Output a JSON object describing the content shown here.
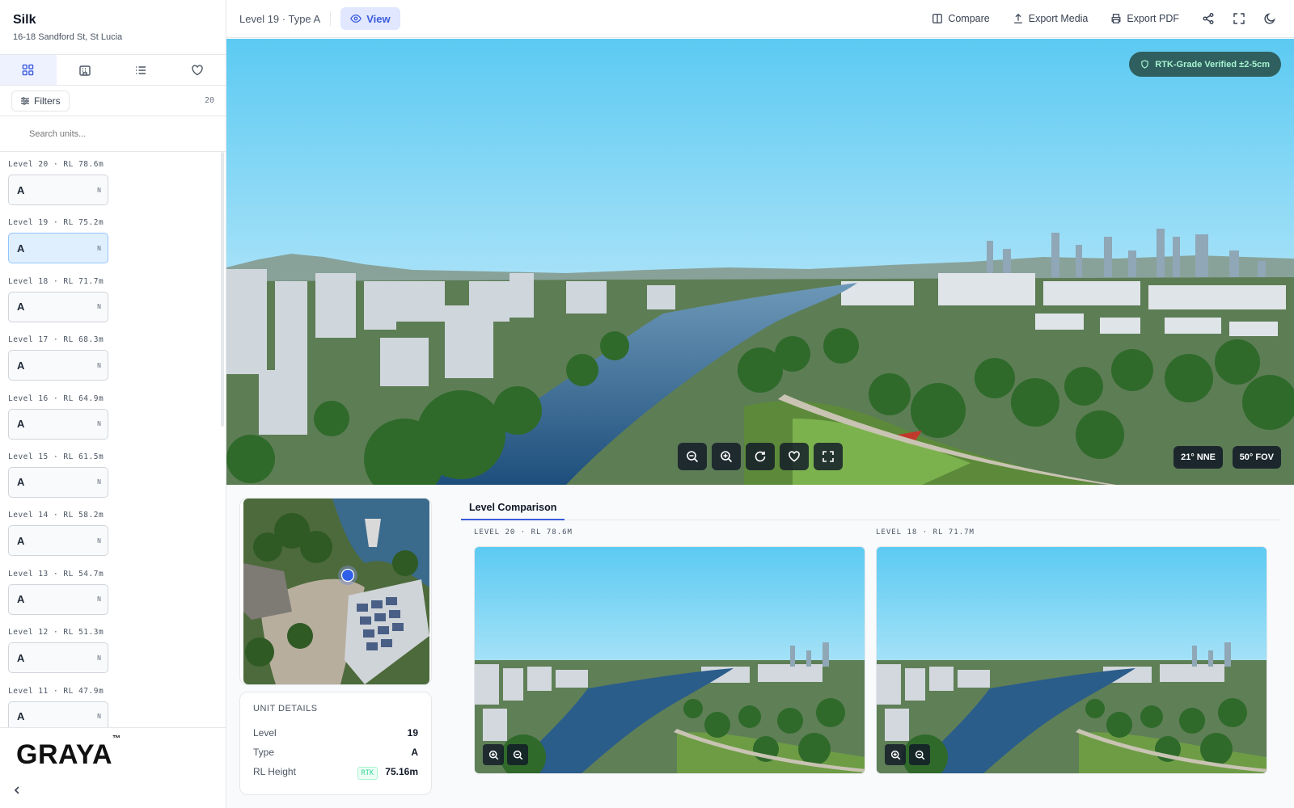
{
  "project": {
    "name": "Silk",
    "address": "16-18 Sandford St, St Lucia"
  },
  "sidebar": {
    "tabs": [
      {
        "icon": "grid-icon"
      },
      {
        "icon": "building-icon"
      },
      {
        "icon": "list-icon"
      },
      {
        "icon": "heart-icon"
      }
    ],
    "filters_label": "Filters",
    "unit_count": "20",
    "search_placeholder": "Search units...",
    "levels": [
      {
        "label": "Level 20 · RL 78.6m",
        "type": "A",
        "orientation": "N",
        "selected": false
      },
      {
        "label": "Level 19 · RL 75.2m",
        "type": "A",
        "orientation": "N",
        "selected": true
      },
      {
        "label": "Level 18 · RL 71.7m",
        "type": "A",
        "orientation": "N",
        "selected": false
      },
      {
        "label": "Level 17 · RL 68.3m",
        "type": "A",
        "orientation": "N",
        "selected": false
      },
      {
        "label": "Level 16 · RL 64.9m",
        "type": "A",
        "orientation": "N",
        "selected": false
      },
      {
        "label": "Level 15 · RL 61.5m",
        "type": "A",
        "orientation": "N",
        "selected": false
      },
      {
        "label": "Level 14 · RL 58.2m",
        "type": "A",
        "orientation": "N",
        "selected": false
      },
      {
        "label": "Level 13 · RL 54.7m",
        "type": "A",
        "orientation": "N",
        "selected": false
      },
      {
        "label": "Level 12 · RL 51.3m",
        "type": "A",
        "orientation": "N",
        "selected": false
      },
      {
        "label": "Level 11 · RL 47.9m",
        "type": "A",
        "orientation": "N",
        "selected": false
      }
    ],
    "brand": "GRAYA",
    "brand_tm": "™"
  },
  "header": {
    "breadcrumb": "Level 19 · Type A",
    "view_label": "View",
    "compare_label": "Compare",
    "export_media_label": "Export Media",
    "export_pdf_label": "Export PDF"
  },
  "viewer": {
    "rtk_badge": "RTK-Grade Verified ±2-5cm",
    "heading": "21° NNE",
    "fov": "50° FOV"
  },
  "unit_details": {
    "title": "UNIT DETAILS",
    "level_label": "Level",
    "level_value": "19",
    "type_label": "Type",
    "type_value": "A",
    "rl_label": "RL Height",
    "rl_tag": "RTK",
    "rl_value": "75.16m"
  },
  "comparison": {
    "tab_label": "Level Comparison",
    "left_label": "LEVEL 20 · RL 78.6M",
    "right_label": "LEVEL 18 · RL 71.7M"
  },
  "colors": {
    "accent": "#3b5bdb",
    "rtk_bg": "#2f5f5f",
    "rtk_text": "#a7f3d0",
    "selected_unit": "#e0effe"
  }
}
